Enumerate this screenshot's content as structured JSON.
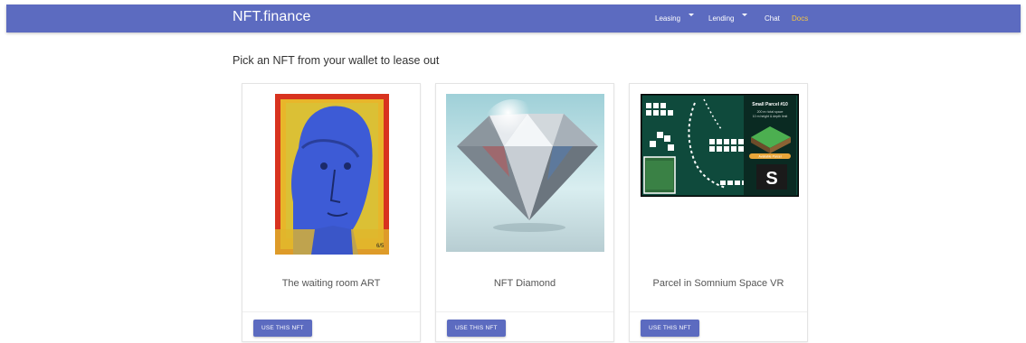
{
  "header": {
    "brand": "NFT.finance",
    "nav": {
      "leasing": "Leasing",
      "lending": "Lending",
      "chat": "Chat",
      "docs": "Docs"
    }
  },
  "main": {
    "heading": "Pick an NFT from your wallet to lease out",
    "cards": [
      {
        "title": "The waiting room ART",
        "button": "USE THIS NFT",
        "image_label": "6/5"
      },
      {
        "title": "NFT Diamond",
        "button": "USE THIS NFT"
      },
      {
        "title": "Parcel in Somnium Space VR",
        "button": "USE THIS NFT",
        "image_text": {
          "parcel_title": "Small Parcel #10",
          "line1": "200 m² total space",
          "line2": "10 m height & depth limit",
          "badge": "Available Parcel",
          "logo": "S"
        }
      }
    ]
  },
  "colors": {
    "primary": "#5c6bc0",
    "docs": "#f5c542"
  }
}
